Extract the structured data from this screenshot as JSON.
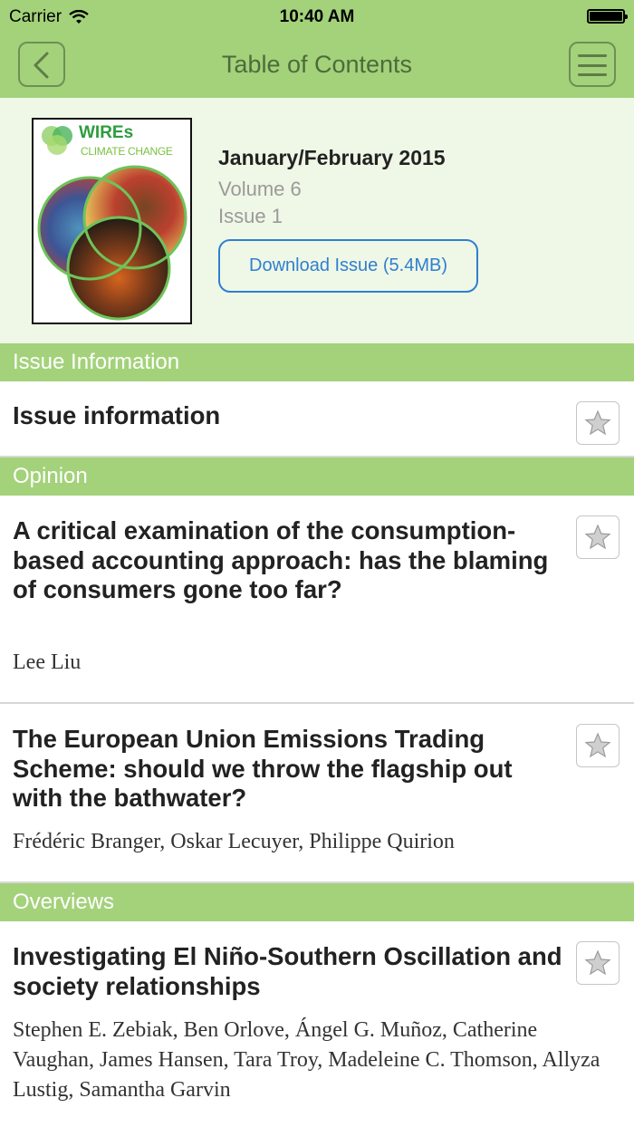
{
  "status_bar": {
    "carrier": "Carrier",
    "time": "10:40 AM"
  },
  "nav": {
    "title": "Table of Contents",
    "back_icon": "chevron-left-icon",
    "menu_icon": "hamburger-menu-icon"
  },
  "issue": {
    "cover_journal": "WIREs",
    "cover_subtitle": "CLIMATE CHANGE",
    "date": "January/February 2015",
    "volume": "Volume 6",
    "issue": "Issue 1",
    "download_label": "Download Issue (5.4MB)"
  },
  "sections": [
    {
      "title": "Issue Information",
      "articles": [
        {
          "title": "Issue information",
          "authors": ""
        }
      ]
    },
    {
      "title": "Opinion",
      "articles": [
        {
          "title": "A critical examination of the consumption-based accounting approach: has the blaming of consumers gone too far?",
          "authors": "Lee Liu"
        },
        {
          "title": "The European Union Emissions Trading Scheme: should we throw the flagship out with the bathwater?",
          "authors": "Frédéric Branger, Oskar Lecuyer, Philippe Quirion"
        }
      ]
    },
    {
      "title": "Overviews",
      "articles": [
        {
          "title": "Investigating El Niño-Southern Oscillation and society relationships",
          "authors": "Stephen E. Zebiak, Ben Orlove, Ángel G. Muñoz, Catherine Vaughan, James Hansen, Tara Troy, Madeleine C. Thomson, Allyza Lustig, Samantha Garvin"
        }
      ]
    }
  ],
  "colors": {
    "accent_green": "#a3d27a",
    "header_bg": "#eff8e6",
    "link_blue": "#2f7fd1"
  }
}
